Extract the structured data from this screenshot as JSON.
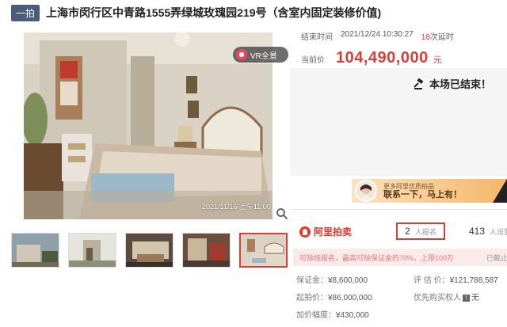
{
  "header": {
    "badge": "一拍",
    "title": "上海市闵行区中青路1555弄绿城玫瑰园219号（含室内固定装修价值)"
  },
  "gallery": {
    "vr_label": "VR全景",
    "photo_date": "2021/11/16 上午11:00",
    "thumbnails": 5,
    "active_thumbnail": 5
  },
  "auction": {
    "end_label": "结束时间",
    "end_time": "2021/12/24 10:30:27",
    "delay_count": "18",
    "delay_label": "次延时",
    "price_label": "当前价",
    "price": "104,490,000",
    "price_unit": "元",
    "ended_text": "本场已结束！"
  },
  "promo": {
    "line1": "更多阿里优质拍品",
    "line2": "联系一下，马上有！"
  },
  "platform": {
    "logo_text": "阿里拍卖",
    "signup_count": "2",
    "signup_label": "人报名",
    "remind_count": "413",
    "remind_label": "人设置提醒"
  },
  "notice": {
    "text": "可除核报名，最高可除保证金的70%，上限100万",
    "right": "已截止"
  },
  "details": {
    "deposit_label": "保证金：",
    "deposit": "¥8,600,000",
    "start_label": "起拍价：",
    "start": "¥86,000,000",
    "increment_label": "加价幅度：",
    "increment": "¥430,000",
    "appraisal_label": "评 估 价：",
    "appraisal": "¥121,788,587",
    "priority_label": "优先购买权人",
    "priority_value": "无"
  },
  "colors": {
    "accent_red": "#d43f3a",
    "badge_bg": "#4a5b7e",
    "promo_orange": "#f6b66a"
  }
}
